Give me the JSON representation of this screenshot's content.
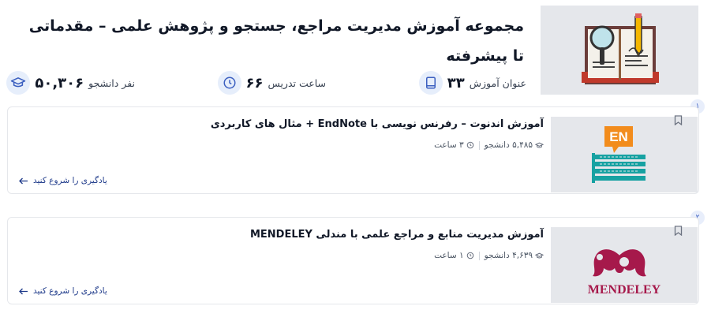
{
  "header": {
    "title": "مجموعه آموزش مدیریت مراجع، جستجو و پژوهش علمی – مقدماتی تا پیشرفته",
    "stats": {
      "lessons": {
        "value": "۳۳",
        "label": "عنوان آموزش",
        "icon": "book-icon"
      },
      "hours": {
        "value": "۶۶",
        "label": "ساعت تدریس",
        "icon": "clock-icon"
      },
      "students": {
        "value": "۵۰,۳۰۶",
        "label": "نفر دانشجو",
        "icon": "graduation-cap-icon"
      }
    }
  },
  "courses": [
    {
      "index": "۱",
      "title": "آموزش اندنوت – رفرنس نویسی با EndNote + مثال های کاربردی",
      "students": "۵,۴۸۵ دانشجو",
      "hours": "۳ ساعت",
      "start_label": "یادگیری را شروع کنید",
      "thumb_badge": "EN"
    },
    {
      "index": "۲",
      "title": "آموزش مدیریت منابع و مراجع علمی با مندلی MENDELEY",
      "students": "۴,۶۳۹ دانشجو",
      "hours": "۱ ساعت",
      "start_label": "یادگیری را شروع کنید",
      "thumb_wordmark": "MENDELEY"
    }
  ],
  "colors": {
    "accent": "#3b5fc0",
    "link": "#1e3a8a",
    "endnote_orange": "#f28c1c",
    "endnote_teal": "#17a2a2",
    "mendeley_red": "#a6194b"
  }
}
